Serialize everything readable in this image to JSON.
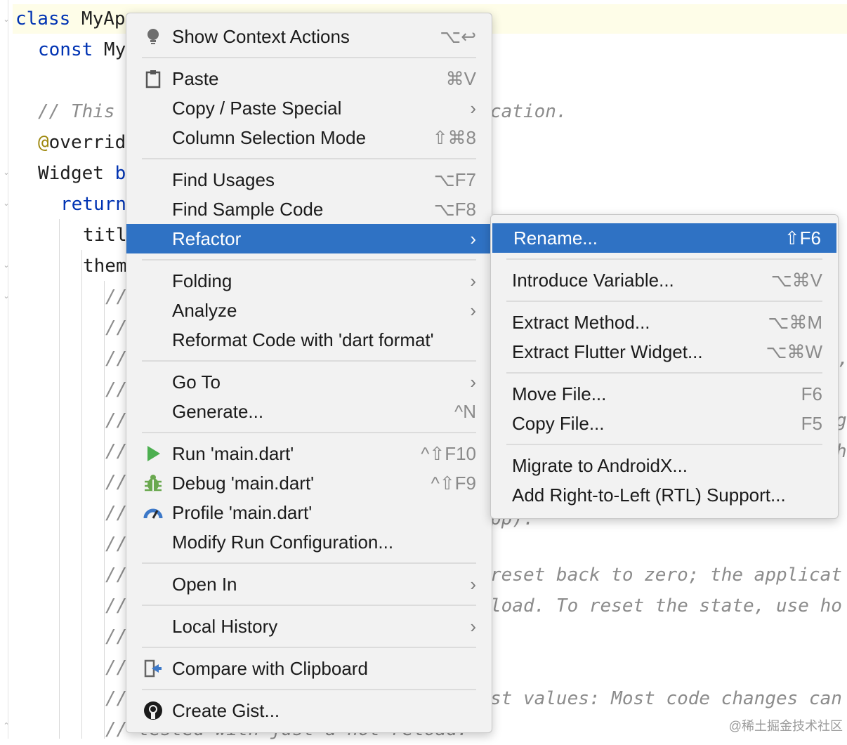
{
  "editor": {
    "lines": [
      {
        "text_a": "class ",
        "text_b": "MyAp"
      },
      {
        "text_a": "const ",
        "text_b": "My"
      },
      {
        "text_a": "// This"
      },
      {
        "text_a": "@",
        "text_b": "overrid"
      },
      {
        "text_a": "Widget ",
        "text_b": "b"
      },
      {
        "text_a": "return"
      },
      {
        "text_a": "titl"
      },
      {
        "text_a": "them"
      }
    ],
    "comment_slash": "//",
    "right_fragments": {
      "cation": "cation.",
      "reset": "reset back to zero; the applicat",
      "load": "load. To reset the state, use ho",
      "values": "st values: Most code changes can",
      "pp": "pp).",
      "g": "g",
      "h": "h",
      "comma": ","
    },
    "bottom_line": "tested with just a hot reload."
  },
  "context_menu": {
    "items": [
      {
        "label": "Show Context Actions",
        "shortcut": "⌥↩",
        "icon": "bulb-icon"
      },
      {
        "label": "Paste",
        "shortcut": "⌘V",
        "icon": "clipboard-icon"
      },
      {
        "label": "Copy / Paste Special",
        "chevron": "›"
      },
      {
        "label": "Column Selection Mode",
        "shortcut": "⇧⌘8"
      },
      {
        "label": "Find Usages",
        "shortcut": "⌥F7"
      },
      {
        "label": "Find Sample Code",
        "shortcut": "⌥F8"
      },
      {
        "label": "Refactor",
        "chevron": "›",
        "selected": true
      },
      {
        "label": "Folding",
        "chevron": "›"
      },
      {
        "label": "Analyze",
        "chevron": "›"
      },
      {
        "label": "Reformat Code with 'dart format'"
      },
      {
        "label": "Go To",
        "chevron": "›"
      },
      {
        "label": "Generate...",
        "shortcut": "^N"
      },
      {
        "label": "Run 'main.dart'",
        "shortcut": "^⇧F10",
        "icon": "run-icon"
      },
      {
        "label": "Debug 'main.dart'",
        "shortcut": "^⇧F9",
        "icon": "debug-icon"
      },
      {
        "label": "Profile 'main.dart'",
        "icon": "profile-icon"
      },
      {
        "label": "Modify Run Configuration..."
      },
      {
        "label": "Open In",
        "chevron": "›"
      },
      {
        "label": "Local History",
        "chevron": "›"
      },
      {
        "label": "Compare with Clipboard",
        "icon": "compare-icon"
      },
      {
        "label": "Create Gist...",
        "icon": "github-icon"
      }
    ]
  },
  "refactor_submenu": {
    "items": [
      {
        "label": "Rename...",
        "shortcut": "⇧F6",
        "selected": true
      },
      {
        "label": "Introduce Variable...",
        "shortcut": "⌥⌘V"
      },
      {
        "label": "Extract Method...",
        "shortcut": "⌥⌘M"
      },
      {
        "label": "Extract Flutter Widget...",
        "shortcut": "⌥⌘W"
      },
      {
        "label": "Move File...",
        "shortcut": "F6"
      },
      {
        "label": "Copy File...",
        "shortcut": "F5"
      },
      {
        "label": "Migrate to AndroidX..."
      },
      {
        "label": "Add Right-to-Left (RTL) Support..."
      }
    ]
  },
  "colors": {
    "selection": "#2f72c4",
    "run": "#4caf50",
    "debug": "#6aa84f",
    "profile": "#3c78c8"
  },
  "watermark": "@稀土掘金技术社区"
}
